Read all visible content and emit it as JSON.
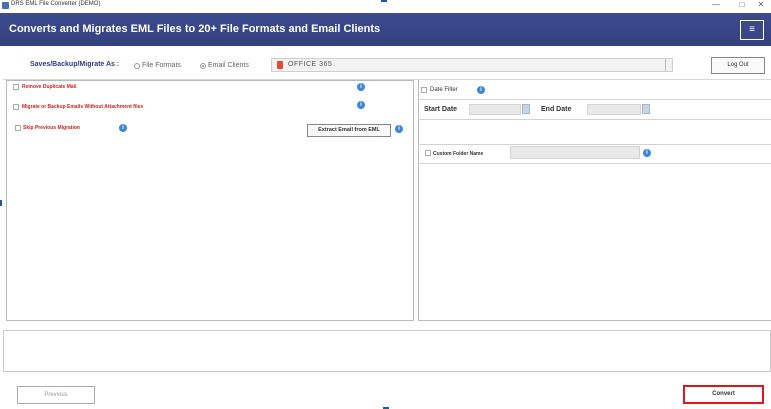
{
  "window": {
    "title": "DRS EML File Converter (DEMO)",
    "minimize": "—",
    "maximize": "□",
    "close": "✕"
  },
  "header": {
    "title": "Converts and Migrates EML Files to 20+ File Formats and Email Clients",
    "menu_icon": "≡"
  },
  "save_as": {
    "label": "Saves/Backup/Migrate As :",
    "option_file_formats": "File Formats",
    "option_email_clients": "Email Clients",
    "selected_option": "Email Clients",
    "destination_icon": "office365-icon",
    "destination_value": "OFFICE 365"
  },
  "logout_label": "Log Out",
  "options": {
    "remove_duplicate": "Remove Duplicate Mail",
    "migrate_without_attachment": "Migrate or Backup Emails Without Attachment files",
    "skip_previous": "Skip Previous Migration",
    "extract_email": "Extract Email from EML"
  },
  "date_filter": {
    "label": "Date Filter",
    "start_label": "Start Date",
    "end_label": "End Date"
  },
  "custom_folder": {
    "label": "Custom Folder Name"
  },
  "footer": {
    "previous_label": "Previous",
    "convert_label": "Convert"
  },
  "colors": {
    "header_bg": "#3c4a8f",
    "accent_blue": "#2b3a8a",
    "option_red": "#d02020",
    "convert_border": "#e0161a",
    "info_icon": "#3d86d8"
  }
}
